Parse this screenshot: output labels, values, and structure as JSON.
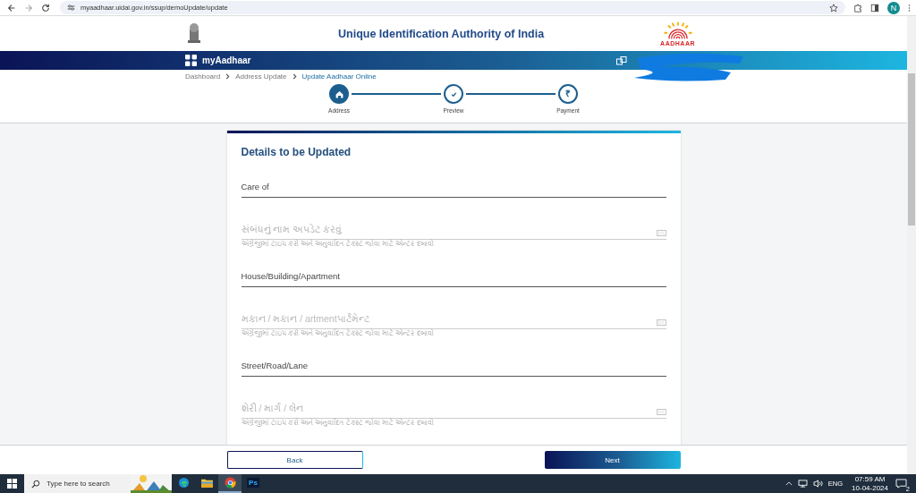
{
  "browser": {
    "url": "myaadhaar.uidai.gov.in/ssup/demoUpdate/update",
    "profile_initial": "N"
  },
  "header": {
    "title": "Unique Identification Authority of India",
    "logo_text": "AADHAAR"
  },
  "nav_bar": {
    "brand": "myAadhaar"
  },
  "breadcrumb": [
    {
      "label": "Dashboard",
      "current": false
    },
    {
      "label": "Address Update",
      "current": false
    },
    {
      "label": "Update Aadhaar Online",
      "current": true
    }
  ],
  "steps": [
    {
      "label": "Address",
      "kind": "home",
      "selected": true
    },
    {
      "label": "Preview",
      "kind": "check",
      "selected": false
    },
    {
      "label": "Payment",
      "kind": "symbol",
      "selected": false,
      "symbol": "₹"
    }
  ],
  "form": {
    "title": "Details to be Updated",
    "fields": [
      {
        "kind": "english",
        "placeholder": "Care of"
      },
      {
        "kind": "translated",
        "placeholder": "સંબંધનું નામ અપડેટ કરવું",
        "hint": "અંગ્રેજીમાં ટાઇપ કરો અને અનુવાદિત ટેક્સ્ટ જોવા માટે એન્ટર દબાવો"
      },
      {
        "kind": "english",
        "placeholder": "House/Building/Apartment"
      },
      {
        "kind": "translated",
        "placeholder": "મકાન / મકાન / artmentપાર્ટમેન્ટ",
        "hint": "અંગ્રેજીમાં ટાઇપ કરો અને અનુવાદિત ટેક્સ્ટ જોવા માટે એન્ટર દબાવો"
      },
      {
        "kind": "english",
        "placeholder": "Street/Road/Lane"
      },
      {
        "kind": "translated",
        "placeholder": "શેરી / માર્ગ / લેન",
        "hint": "અંગ્રેજીમાં ટાઇપ કરો અને અનુવાદિત ટેક્સ્ટ જોવા માટે એન્ટર દબાવો"
      }
    ]
  },
  "buttons": [
    {
      "label": "Back",
      "kind": "outline"
    },
    {
      "label": "Next",
      "kind": "primary"
    }
  ],
  "taskbar": {
    "search_placeholder": "Type here to search",
    "apps": [
      {
        "kind": "edge",
        "active": false
      },
      {
        "kind": "folder",
        "active": false
      },
      {
        "kind": "chrome",
        "active": true
      },
      {
        "kind": "ps",
        "active": false,
        "text": "Ps"
      }
    ],
    "language": "ENG",
    "time": "07:59 AM",
    "date": "10-04-2024",
    "notifications": "2"
  }
}
